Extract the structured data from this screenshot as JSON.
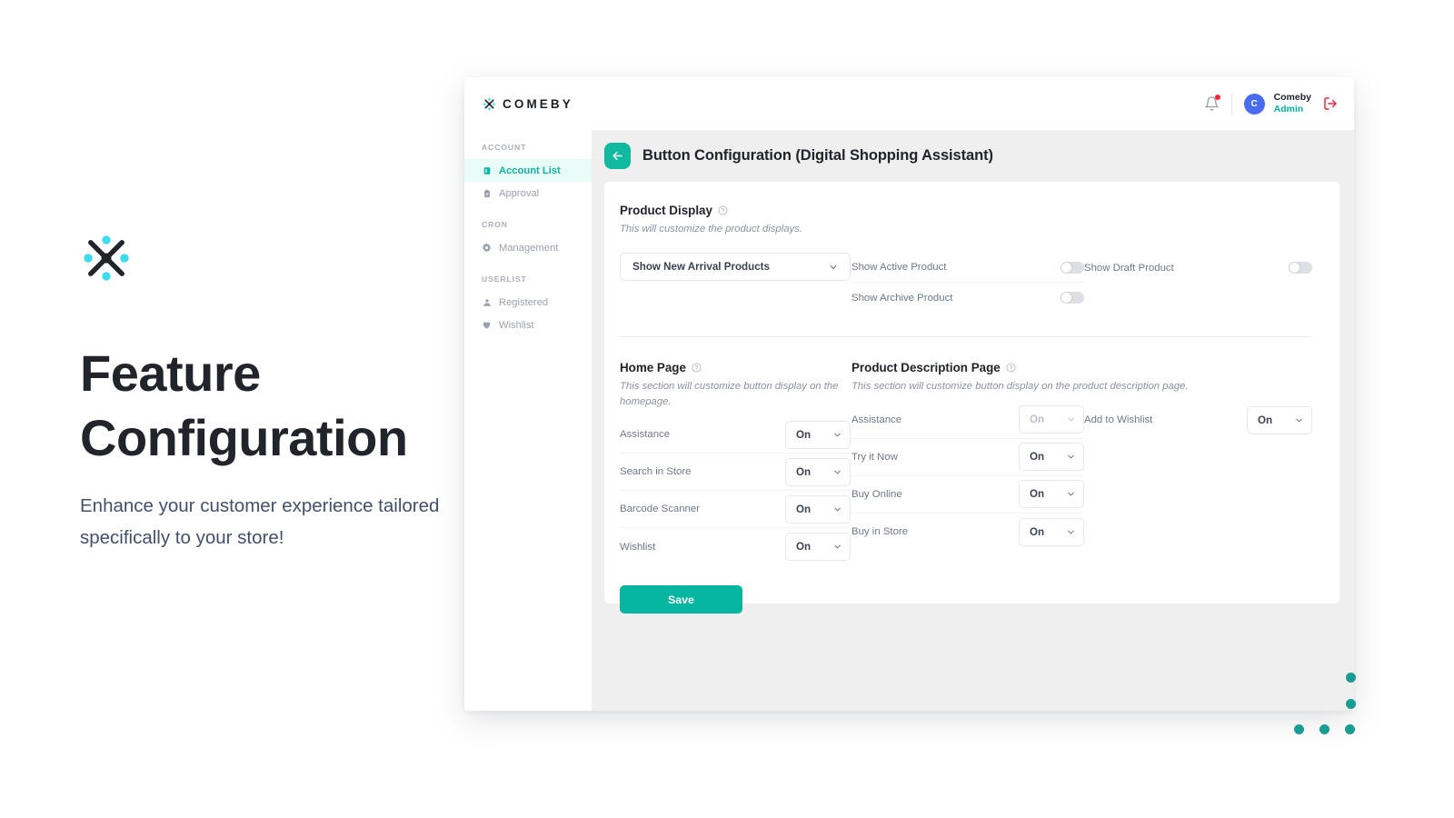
{
  "promo": {
    "logo_icon": "comeby-x-logo",
    "title_line1": "Feature",
    "title_line2": "Configuration",
    "subtitle": "Enhance your customer experience tailored specifically to your store!"
  },
  "topbar": {
    "brand": "COMEBY",
    "brand_icon": "comeby-x-logo",
    "bell_icon": "bell-icon",
    "notification_dot": true,
    "avatar_initial": "C",
    "user_name": "Comeby",
    "user_role": "Admin",
    "logout_icon": "logout-icon"
  },
  "sidebar": {
    "groups": [
      {
        "label": "ACCOUNT",
        "items": [
          {
            "label": "Account List",
            "icon": "list-icon",
            "active": true
          },
          {
            "label": "Approval",
            "icon": "clipboard-check-icon",
            "active": false
          }
        ]
      },
      {
        "label": "CRON",
        "items": [
          {
            "label": "Management",
            "icon": "gear-icon",
            "active": false
          }
        ]
      },
      {
        "label": "USERLIST",
        "items": [
          {
            "label": "Registered",
            "icon": "user-icon",
            "active": false
          },
          {
            "label": "Wishlist",
            "icon": "heart-icon",
            "active": false
          }
        ]
      }
    ]
  },
  "page": {
    "back_icon": "arrow-left-icon",
    "title": "Button Configuration (Digital Shopping Assistant)"
  },
  "product_display": {
    "title": "Product Display",
    "help_icon": "question-circle-icon",
    "description": "This will customize the product displays.",
    "select": {
      "value": "Show New Arrival Products",
      "chevron_icon": "chevron-down-icon"
    },
    "toggles_col1": [
      {
        "label": "Show Active Product",
        "state": "off"
      },
      {
        "label": "Show Archive Product",
        "state": "off"
      }
    ],
    "toggles_col2": [
      {
        "label": "Show Draft Product",
        "state": "off"
      }
    ]
  },
  "home_page": {
    "title": "Home Page",
    "help_icon": "question-circle-icon",
    "description": "This section will customize button display on the homepage.",
    "options": [
      {
        "label": "Assistance",
        "value": "On",
        "disabled": false
      },
      {
        "label": "Search in Store",
        "value": "On",
        "disabled": false
      },
      {
        "label": "Barcode Scanner",
        "value": "On",
        "disabled": false
      },
      {
        "label": "Wishlist",
        "value": "On",
        "disabled": false
      }
    ]
  },
  "product_description_page": {
    "title": "Product Description Page",
    "help_icon": "question-circle-icon",
    "description": "This section will customize button display on the product description page.",
    "options_col1": [
      {
        "label": "Assistance",
        "value": "On",
        "disabled": true
      },
      {
        "label": "Try it Now",
        "value": "On",
        "disabled": false
      },
      {
        "label": "Buy Online",
        "value": "On",
        "disabled": false
      },
      {
        "label": "Buy in Store",
        "value": "On",
        "disabled": false
      }
    ],
    "options_col2": [
      {
        "label": "Add to Wishlist",
        "value": "On",
        "disabled": false
      }
    ]
  },
  "actions": {
    "save_label": "Save"
  },
  "colors": {
    "accent_teal": "#10b99f",
    "save_teal": "#06b6a0",
    "active_nav_bg": "#e9fbf7",
    "logo_cyan": "#3fdbec",
    "avatar_blue": "#4a6cf0",
    "logout_red": "#f0273d",
    "content_bg": "#efefef",
    "decor_dot": "#199c92"
  }
}
